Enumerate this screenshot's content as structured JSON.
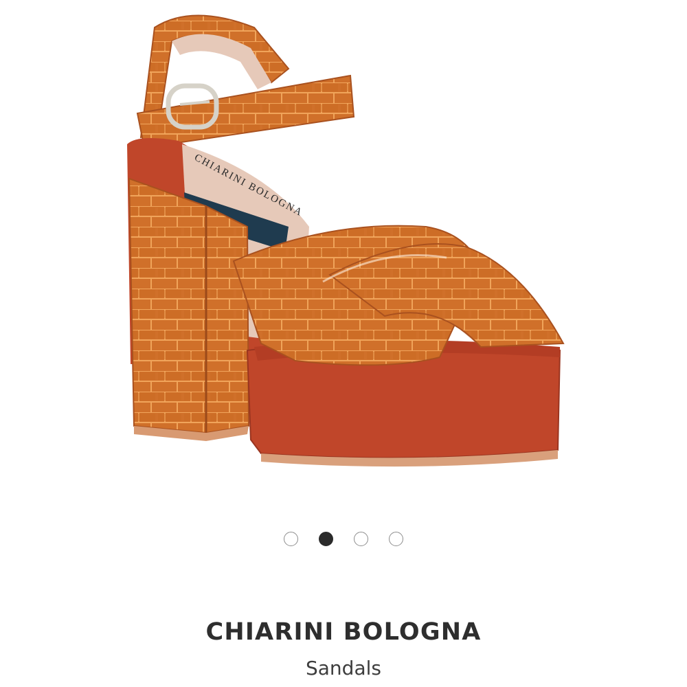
{
  "gallery": {
    "image_alt": "Sandals",
    "page_count": 4,
    "active_index": 1
  },
  "product": {
    "brand": "CHIARINI BOLOGNA",
    "category": "Sandals",
    "insole_logo_text": "CHIARINI BOLOGNA"
  },
  "colors": {
    "leather": "#d0702a",
    "leather_dark": "#a9511f",
    "platform": "#c0462a",
    "platform_dark": "#9a3520",
    "lining": "#e6c9b9",
    "buckle": "#d6d2c8"
  }
}
